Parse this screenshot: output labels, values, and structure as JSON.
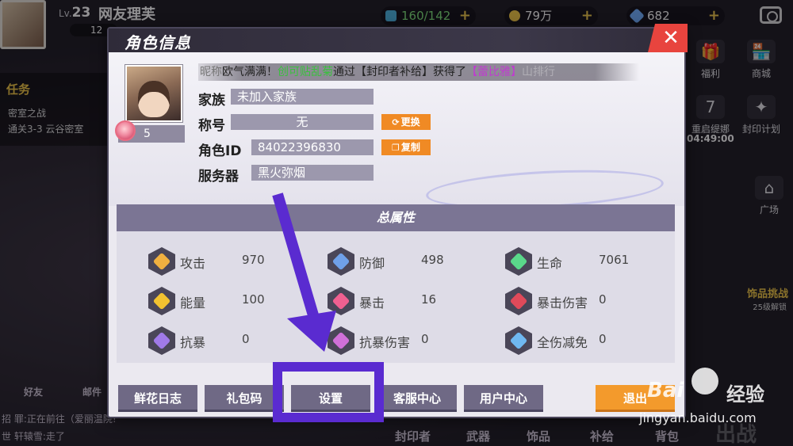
{
  "hud": {
    "level_prefix": "Lv.",
    "level": "23",
    "player_name": "网友理芙",
    "power": "12",
    "stamina": "160/142",
    "gold": "79万",
    "gems": "682",
    "plus": "+"
  },
  "task": {
    "title": "任务",
    "subtitle": "密室之战",
    "desc": "通关3-3 云谷密室"
  },
  "right_menu": [
    {
      "label": "福利",
      "icon": "gift-icon"
    },
    {
      "label": "商城",
      "icon": "shop-icon"
    },
    {
      "label": "重启缇娜",
      "icon": "calendar-icon"
    },
    {
      "label": "封印计划",
      "icon": "seal-icon"
    },
    {
      "label": "广场",
      "icon": "plaza-icon"
    }
  ],
  "countdown": "04:49:00",
  "challenge": {
    "title": "饰品挑战",
    "sub": "25级解锁"
  },
  "bottom_tabs": [
    "好友",
    "邮件",
    "封印者",
    "武器",
    "饰品",
    "补给",
    "背包"
  ],
  "go_battle": "出战",
  "chat": [
    "招  罪:正在前往（爱丽温院!",
    "世  轩辕雪:走了"
  ],
  "dialog": {
    "title": "角色信息",
    "close_label": "✕",
    "ticker": {
      "nick_label": "昵称",
      "pre": "欧气满满！",
      "name1": "创可贴乱菊",
      "mid": "通过【封印者补给】获得了",
      "name2": "【蕾比雅】",
      "tail": "山排行"
    },
    "flower_count": "5",
    "fields": [
      {
        "label": "家族",
        "value": "未加入家族"
      },
      {
        "label": "称号",
        "value": "无"
      },
      {
        "label": "角色ID",
        "value": "84022396830"
      },
      {
        "label": "服务器",
        "value": "黑火弥烟"
      }
    ],
    "change_button": "更换",
    "copy_button": "复制",
    "attr_title": "总属性",
    "stats": [
      {
        "name": "攻击",
        "value": "970",
        "color": "#f0b040"
      },
      {
        "name": "防御",
        "value": "498",
        "color": "#6fa0e8"
      },
      {
        "name": "生命",
        "value": "7061",
        "color": "#5ad88a"
      },
      {
        "name": "能量",
        "value": "100",
        "color": "#f2c230"
      },
      {
        "name": "暴击",
        "value": "16",
        "color": "#f06090"
      },
      {
        "name": "暴击伤害",
        "value": "0",
        "color": "#e04a5a"
      },
      {
        "name": "抗暴",
        "value": "0",
        "color": "#a07ae8"
      },
      {
        "name": "抗暴伤害",
        "value": "0",
        "color": "#d070d8"
      },
      {
        "name": "全伤减免",
        "value": "0",
        "color": "#6fb8f0"
      }
    ],
    "footer_buttons": [
      "鲜花日志",
      "礼包码",
      "设置",
      "客服中心",
      "用户中心",
      "退出"
    ]
  },
  "watermark": {
    "brand": "Bai",
    "brand2": "经验",
    "url": "jingyan.baidu.com"
  },
  "colors": {
    "accent_purple": "#5a2bd0",
    "close_red": "#e8443e",
    "orange": "#f08a24"
  }
}
